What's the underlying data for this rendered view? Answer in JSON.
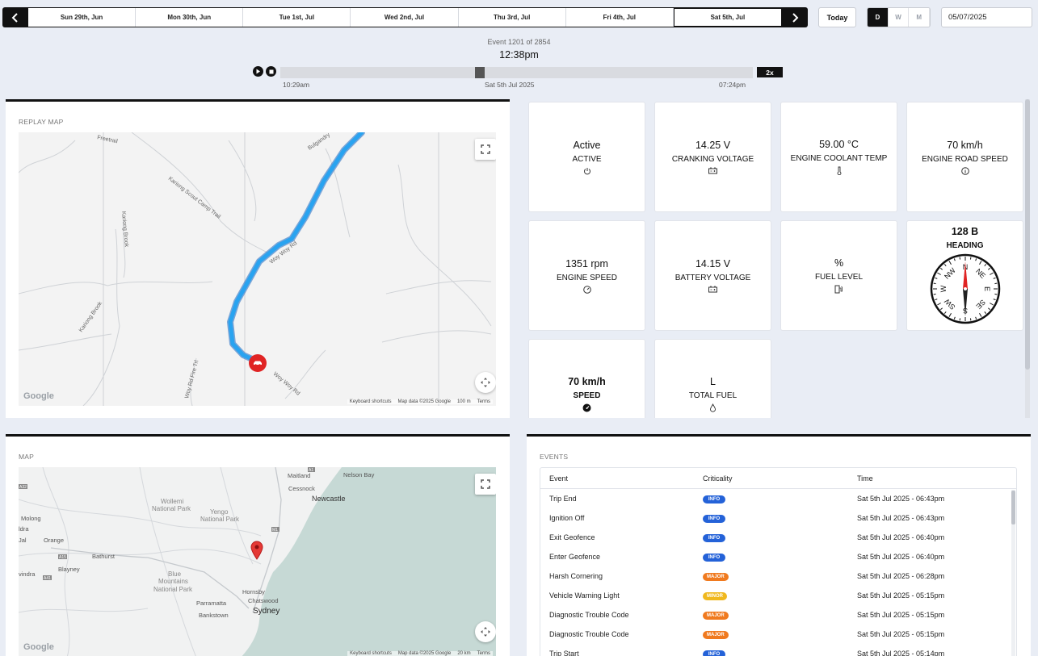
{
  "datebar": {
    "days": [
      "Sun 29th, Jun",
      "Mon 30th, Jun",
      "Tue 1st, Jul",
      "Wed 2nd, Jul",
      "Thu 3rd, Jul",
      "Fri 4th, Jul",
      "Sat 5th, Jul"
    ],
    "active_index": 6,
    "prev_icon": "chevron-left-icon",
    "next_icon": "chevron-right-icon"
  },
  "today_label": "Today",
  "view_modes": [
    "D",
    "W",
    "M"
  ],
  "active_view_mode": "D",
  "date_value": "05/07/2025",
  "replay": {
    "event_count": "Event 1201 of 2854",
    "time": "12:38pm",
    "start_time": "10:29am",
    "date": "Sat 5th Jul 2025",
    "end_time": "07:24pm",
    "speed": "2x",
    "progress_fraction": 0.42
  },
  "replay_map": {
    "title": "REPLAY MAP",
    "labels": [
      "Freetrail",
      "Bulgandry",
      "Kariong Scout Camp Trail",
      "Kariong Brook",
      "Kariong Brook",
      "Woy Woy Rd",
      "Woy Woy Rd",
      "Woy Rd Fire Trl"
    ],
    "attribution": [
      "Keyboard shortcuts",
      "Map data ©2025 Google",
      "100 m",
      "Terms"
    ],
    "google": "Google"
  },
  "metrics": [
    {
      "value": "Active",
      "label": "ACTIVE",
      "icon": "power-icon"
    },
    {
      "value": "14.25 V",
      "label": "CRANKING VOLTAGE",
      "icon": "battery-icon"
    },
    {
      "value": "59.00 °C",
      "label": "ENGINE COOLANT TEMP",
      "icon": "thermometer-icon"
    },
    {
      "value": "70 km/h",
      "label": "ENGINE ROAD SPEED",
      "icon": "info-icon"
    },
    {
      "value": "1351 rpm",
      "label": "ENGINE SPEED",
      "icon": "gauge-icon"
    },
    {
      "value": "14.15 V",
      "label": "BATTERY VOLTAGE",
      "icon": "battery-icon"
    },
    {
      "value": "%",
      "label": "FUEL LEVEL",
      "icon": "fuel-pump-icon"
    },
    {
      "value": "128 B",
      "label": "HEADING",
      "icon": "compass-icon",
      "heading_degrees": 128
    },
    {
      "value": "70 km/h",
      "label": "SPEED",
      "icon": "speedometer-icon"
    },
    {
      "value": "L",
      "label": "TOTAL FUEL",
      "icon": "droplet-icon"
    }
  ],
  "compass_letters": [
    "N",
    "NE",
    "E",
    "SE",
    "S",
    "SW",
    "W",
    "NW"
  ],
  "region_map": {
    "title": "MAP",
    "places": [
      "Maitland",
      "Nelson Bay",
      "Cessnock",
      "Newcastle",
      "Wollemi",
      "National Park",
      "Yengo",
      "National Park",
      "Molong",
      "Orange",
      "Bathurst",
      "Blayney",
      "Blue",
      "Mountains",
      "National Park",
      "Parramatta",
      "Hornsby",
      "Chatswood",
      "Sydney",
      "Bankstown",
      "ldra",
      "Jal",
      "vindra"
    ],
    "roads": [
      "A1",
      "A32",
      "A15",
      "M1",
      "A41"
    ],
    "attribution": [
      "Keyboard shortcuts",
      "Map data ©2025 Google",
      "20 km",
      "Terms"
    ],
    "google": "Google"
  },
  "events": {
    "title": "EVENTS",
    "columns": [
      "Event",
      "Criticality",
      "Time"
    ],
    "rows": [
      {
        "event": "Trip End",
        "criticality": "INFO",
        "time": "Sat 5th Jul 2025 - 06:43pm"
      },
      {
        "event": "Ignition Off",
        "criticality": "INFO",
        "time": "Sat 5th Jul 2025 - 06:43pm"
      },
      {
        "event": "Exit Geofence",
        "criticality": "INFO",
        "time": "Sat 5th Jul 2025 - 06:40pm"
      },
      {
        "event": "Enter Geofence",
        "criticality": "INFO",
        "time": "Sat 5th Jul 2025 - 06:40pm"
      },
      {
        "event": "Harsh Cornering",
        "criticality": "MAJOR",
        "time": "Sat 5th Jul 2025 - 06:28pm"
      },
      {
        "event": "Vehicle Warning Light",
        "criticality": "MINOR",
        "time": "Sat 5th Jul 2025 - 05:15pm"
      },
      {
        "event": "Diagnostic Trouble Code",
        "criticality": "MAJOR",
        "time": "Sat 5th Jul 2025 - 05:15pm"
      },
      {
        "event": "Diagnostic Trouble Code",
        "criticality": "MAJOR",
        "time": "Sat 5th Jul 2025 - 05:15pm"
      },
      {
        "event": "Trip Start",
        "criticality": "INFO",
        "time": "Sat 5th Jul 2025 - 05:14pm"
      }
    ],
    "criticality_colors": {
      "INFO": "#2462d8",
      "MAJOR": "#f07a1f",
      "MINOR": "#f0b81e"
    }
  },
  "colors": {
    "route": "#1f8fe0",
    "vehicle_marker": "#e02424",
    "pin": "#e53935",
    "water": "#c6d9d5"
  }
}
